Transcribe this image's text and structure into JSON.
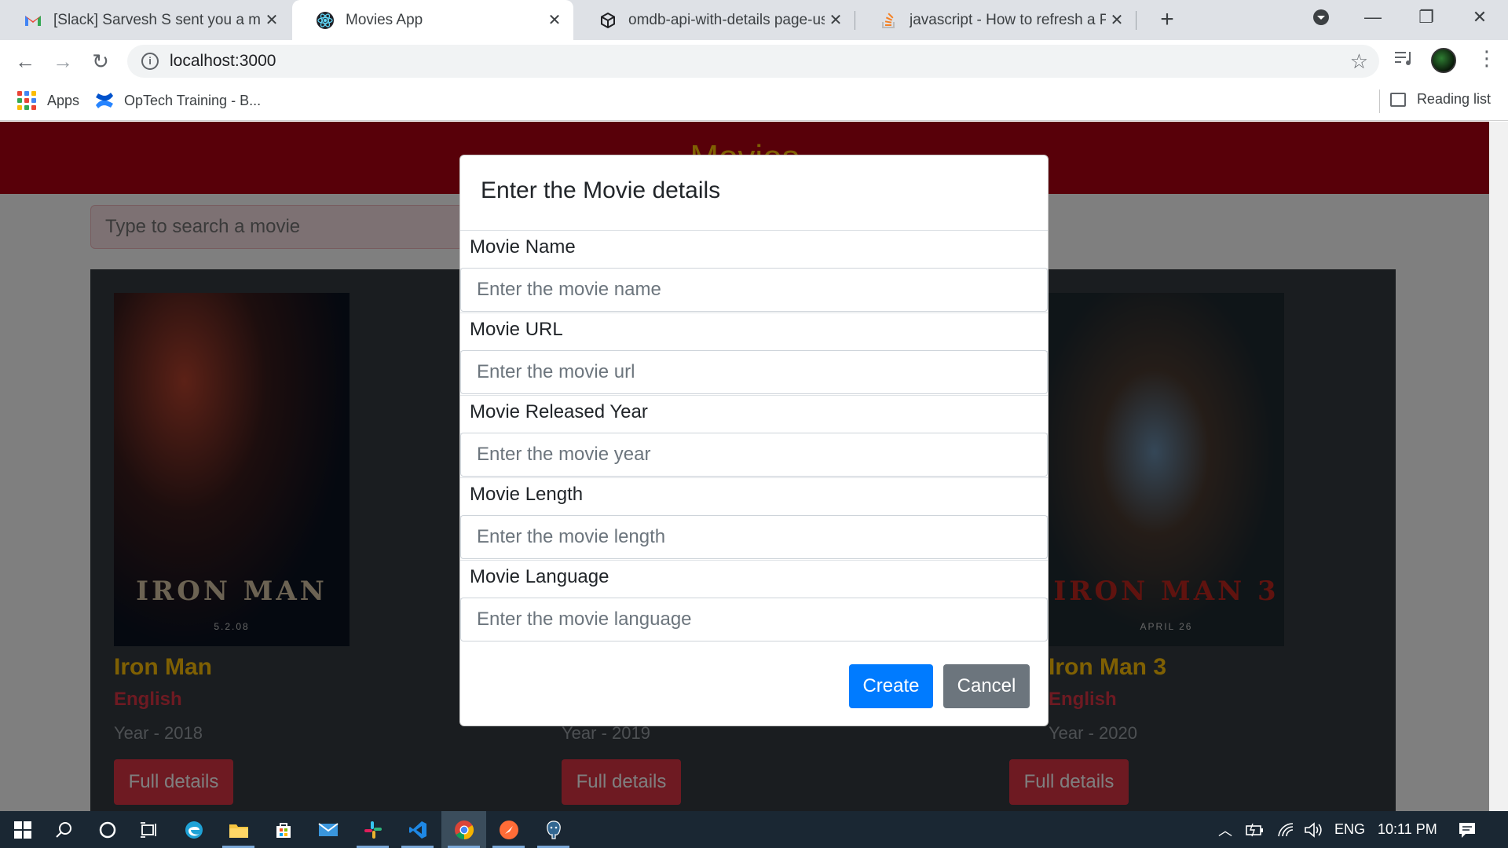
{
  "browser": {
    "tabs": [
      {
        "title": "[Slack] Sarvesh S sent you a mess",
        "icon": "gmail-icon"
      },
      {
        "title": "Movies App",
        "icon": "react-icon"
      },
      {
        "title": "omdb-api-with-details page-usin",
        "icon": "codesandbox-icon"
      },
      {
        "title": "javascript - How to refresh a Pag",
        "icon": "stackoverflow-icon"
      }
    ],
    "url": "localhost:3000",
    "bookmarks": [
      {
        "label": "Apps"
      },
      {
        "label": "OpTech Training - B..."
      }
    ],
    "reading_list": "Reading list"
  },
  "page": {
    "header_title": "Movies",
    "search_placeholder": "Type to search a movie",
    "movies": [
      {
        "title": "Iron Man",
        "language": "English",
        "year": "Year - 2018",
        "button": "Full details",
        "poster_text": "IRON MAN",
        "poster_date": "5.2.08"
      },
      {
        "title": "",
        "language": "",
        "year": "Year - 2019",
        "button": "Full details"
      },
      {
        "title": "Iron Man 3",
        "language": "English",
        "year": "Year - 2020",
        "button": "Full details",
        "poster_text": "IRON MAN 3",
        "poster_date": "APRIL 26"
      }
    ]
  },
  "modal": {
    "title": "Enter the Movie details",
    "fields": [
      {
        "label": "Movie Name",
        "placeholder": "Enter the movie name"
      },
      {
        "label": "Movie URL",
        "placeholder": "Enter the movie url"
      },
      {
        "label": "Movie Released Year",
        "placeholder": "Enter the movie year"
      },
      {
        "label": "Movie Length",
        "placeholder": "Enter the movie length"
      },
      {
        "label": "Movie Language",
        "placeholder": "Enter the movie language"
      }
    ],
    "create_label": "Create",
    "cancel_label": "Cancel"
  },
  "taskbar": {
    "language": "ENG",
    "time": "10:11 PM"
  },
  "colors": {
    "header": "#b00013",
    "title_accent": "#ffc107",
    "danger": "#dc3545",
    "primary": "#007bff",
    "secondary": "#6c757d",
    "card_bg": "#343a40"
  }
}
